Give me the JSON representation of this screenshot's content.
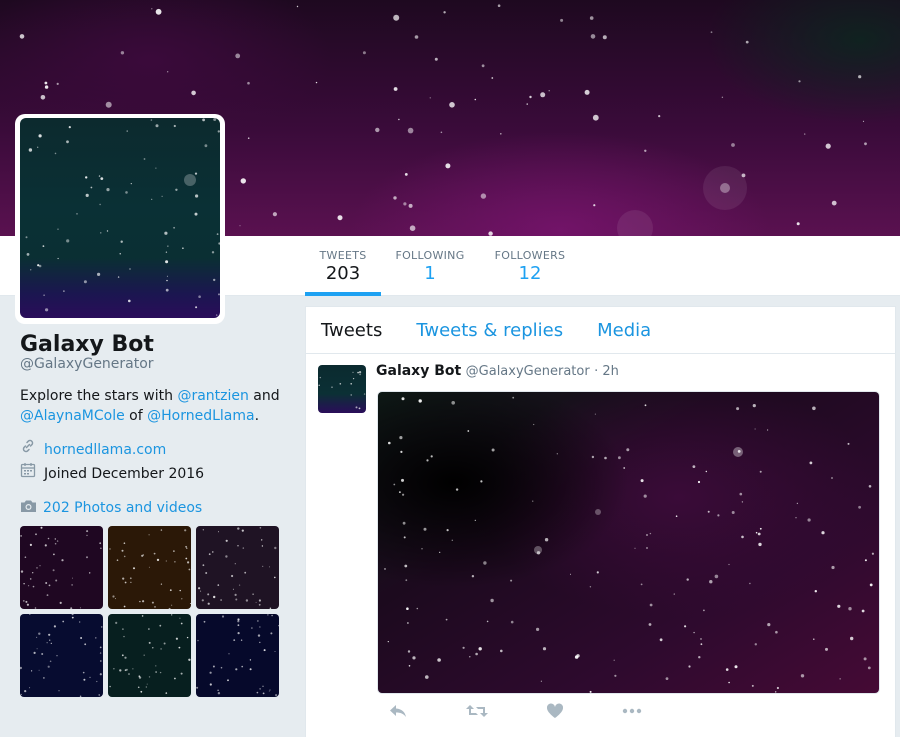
{
  "profile": {
    "name": "Galaxy Bot",
    "handle": "@GalaxyGenerator",
    "bio_prefix": "Explore the stars with ",
    "bio_mention1": "@rantzien",
    "bio_mid1": " and",
    "bio_mention2": "@AlaynaMCole",
    "bio_mid2": " of ",
    "bio_mention3": "@HornedLlama",
    "bio_suffix": ".",
    "website": "hornedllama.com",
    "joined": "Joined December 2016"
  },
  "stats": [
    {
      "label": "TWEETS",
      "value": "203"
    },
    {
      "label": "FOLLOWING",
      "value": "1"
    },
    {
      "label": "FOLLOWERS",
      "value": "12"
    }
  ],
  "photos": {
    "label": "202 Photos and videos",
    "thumb_colors": [
      "#2a0a2e",
      "#3a200a",
      "#2a1a30",
      "#0a1040",
      "#0a2a2a",
      "#080c3a"
    ]
  },
  "tabs": [
    {
      "label": "Tweets"
    },
    {
      "label": "Tweets & replies"
    },
    {
      "label": "Media"
    }
  ],
  "tweet": {
    "name": "Galaxy Bot",
    "handle": "@GalaxyGenerator",
    "time": "· 2h"
  },
  "icons": [
    "link-icon",
    "calendar-icon",
    "camera-icon",
    "reply-icon",
    "retweet-icon",
    "like-icon",
    "more-icon"
  ],
  "colors": {
    "accent": "#1da1f2",
    "link": "#1b95e0",
    "muted": "#657786"
  }
}
